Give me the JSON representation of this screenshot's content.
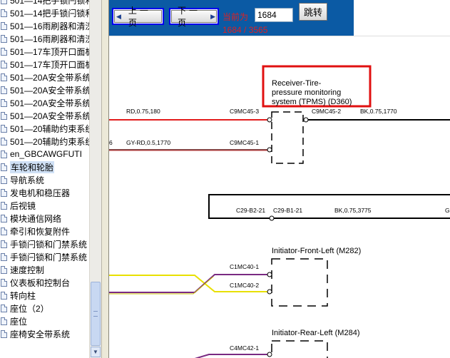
{
  "sidebar": {
    "items": [
      {
        "label": "501—14把手锁闩锁和"
      },
      {
        "label": "501—14把手锁闩锁和"
      },
      {
        "label": "501—16雨刷器和清洗"
      },
      {
        "label": "501—16雨刷器和清洗"
      },
      {
        "label": "501—17车顶开口面板"
      },
      {
        "label": "501—17车顶开口面板"
      },
      {
        "label": "501—20A安全带系统"
      },
      {
        "label": "501—20A安全带系统"
      },
      {
        "label": "501—20A安全带系统"
      },
      {
        "label": "501—20A安全带系统"
      },
      {
        "label": "501—20辅助约束系统"
      },
      {
        "label": "501—20辅助约束系统"
      },
      {
        "label": "en_GBCAWGFUTI"
      },
      {
        "label": "车轮和轮胎"
      },
      {
        "label": "导航系统"
      },
      {
        "label": "发电机和稳压器"
      },
      {
        "label": "后视镜"
      },
      {
        "label": "模块通信网络"
      },
      {
        "label": "牵引和恢复附件"
      },
      {
        "label": "手锁闩锁和门禁系统"
      },
      {
        "label": "手锁闩锁和门禁系统"
      },
      {
        "label": "速度控制"
      },
      {
        "label": "仪表板和控制台"
      },
      {
        "label": "转向柱"
      },
      {
        "label": "座位（2）"
      },
      {
        "label": "座位"
      },
      {
        "label": "座椅安全带系统"
      }
    ],
    "selected_label": "车轮和轮胎"
  },
  "toolbar": {
    "prev_label": "上一页",
    "next_label": "下一页",
    "current_label": "当前为",
    "page_value": "1684",
    "jump_label": "跳转",
    "page_count": "1684 / 3565"
  },
  "diagram": {
    "components": [
      {
        "label_lines": [
          "Receiver-Tire-",
          "pressure monitoring",
          "system (TPMS) (D360)"
        ]
      },
      {
        "label": "Initiator-Front-Left (M282)"
      },
      {
        "label": "Initiator-Rear-Left (M284)"
      }
    ],
    "wire_labels": {
      "w1": "RD,0.75,180",
      "w2": "GY-RD,0.5,1770",
      "w3": "BK,0.75,1770",
      "w4": "BK,0.75,3775",
      "w5_prefix": "6",
      "w6_prefix": "G"
    },
    "connectors": {
      "c1": "C9MC45-3",
      "c2": "C9MC45-1",
      "c3": "C9MC45-2",
      "c4": "C29-B2-21",
      "c5": "C29-B1-21",
      "c6": "C1MC40-1",
      "c7": "C1MC40-2",
      "c8": "C4MC42-1"
    }
  },
  "colors": {
    "toolbar_bg": "#0b5aa4",
    "red_wire": "#e21d1d",
    "gray_red_wire": "#7c4a4a",
    "yellow_wire": "#e8e000",
    "purple_wire": "#7a2a82",
    "highlight_box": "#e01010"
  }
}
